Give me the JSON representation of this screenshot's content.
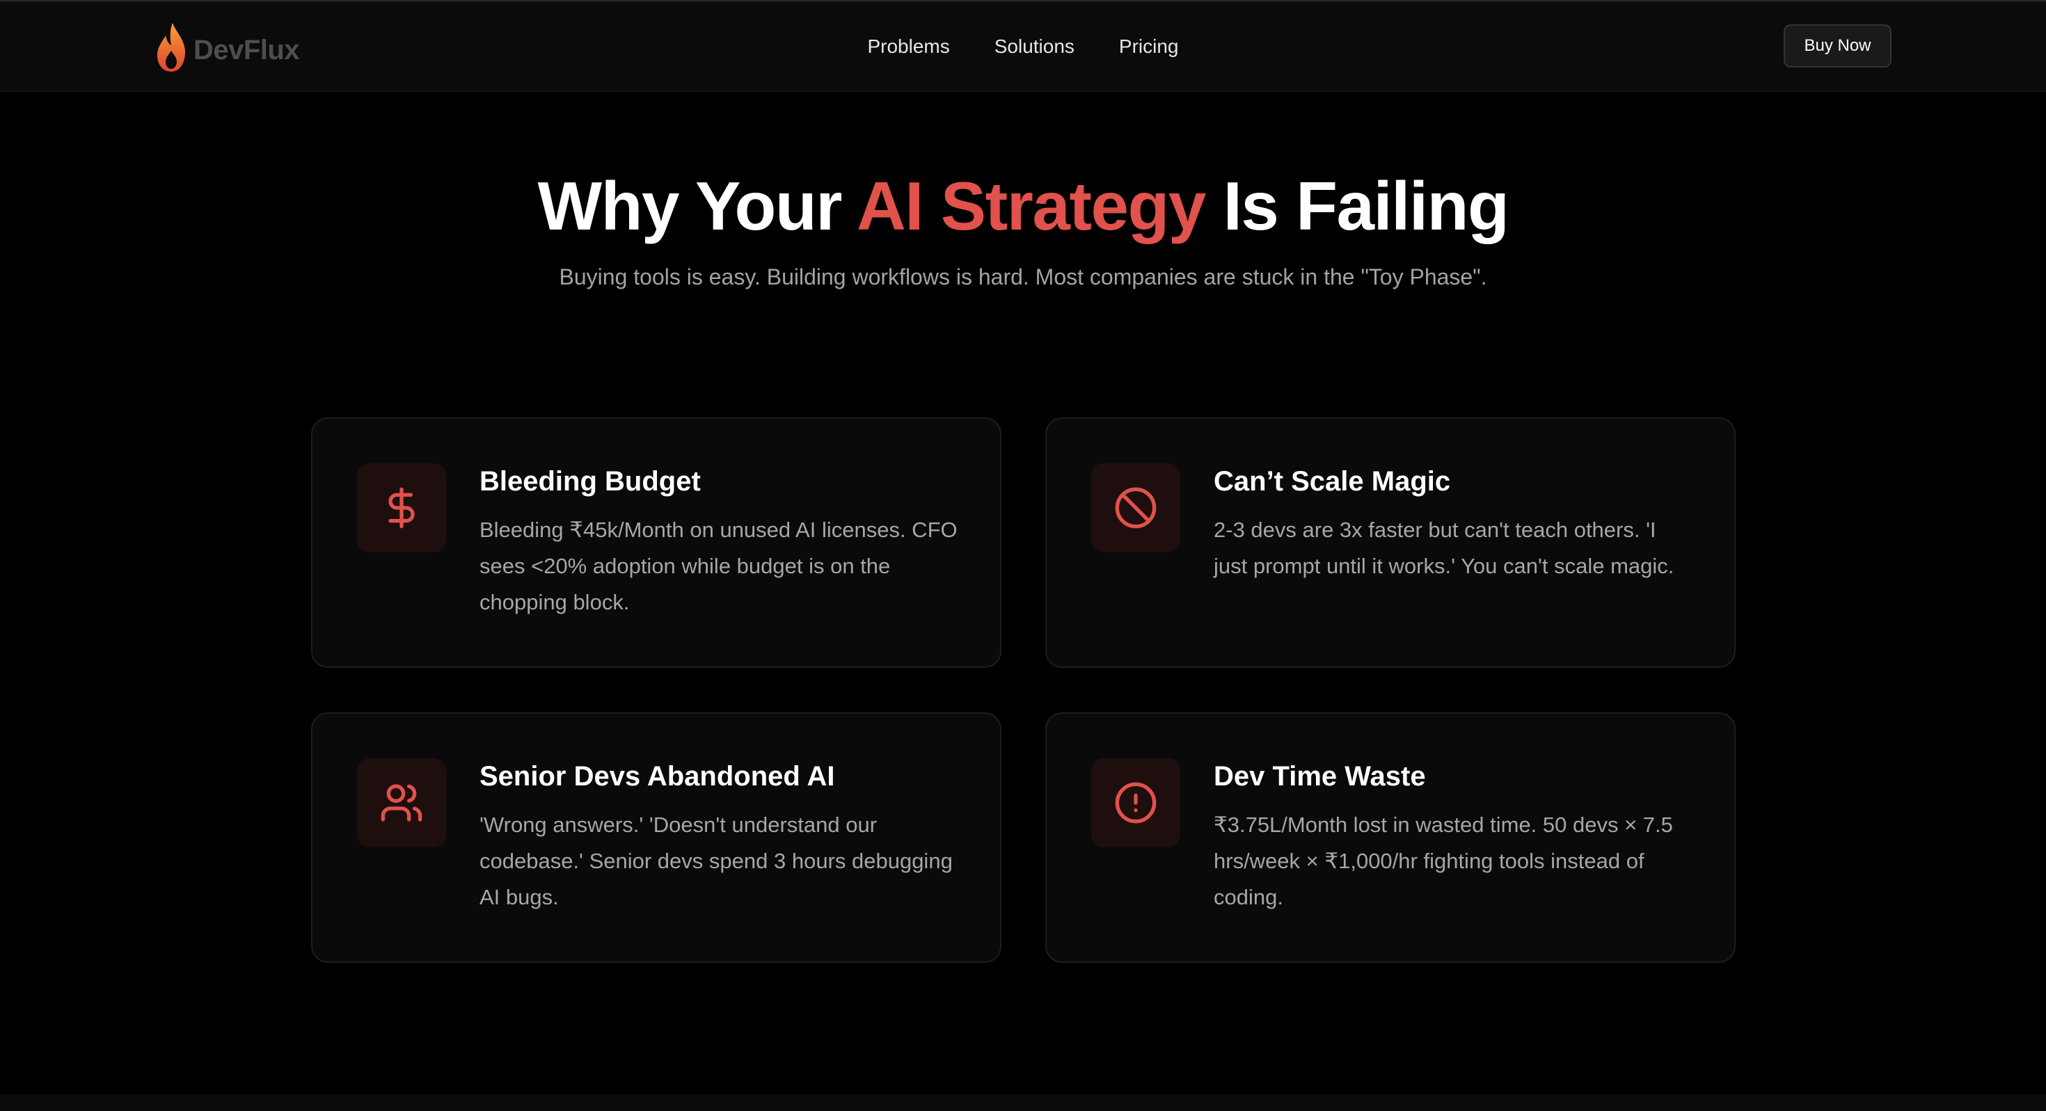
{
  "brand": {
    "name": "DevFlux",
    "logo_icon": "flame-icon",
    "logo_colors": [
      "#f08a2c",
      "#e0452f"
    ]
  },
  "nav": {
    "items": [
      {
        "label": "Problems"
      },
      {
        "label": "Solutions"
      },
      {
        "label": "Pricing"
      }
    ],
    "cta_label": "Buy Now"
  },
  "hero": {
    "title_before": "Why Your ",
    "title_accent": "AI Strategy",
    "title_after": " Is Failing",
    "subtitle": "Buying tools is easy. Building workflows is hard. Most companies are stuck in the \"Toy Phase\"."
  },
  "problems": [
    {
      "icon": "dollar-icon",
      "title": "Bleeding Budget",
      "description": "Bleeding ₹45k/Month on unused AI licenses. CFO sees <20% adoption while budget is on the chopping block."
    },
    {
      "icon": "ban-icon",
      "title": "Can’t Scale Magic",
      "description": "2-3 devs are 3x faster but can't teach others. 'I just prompt until it works.' You can't scale magic."
    },
    {
      "icon": "users-icon",
      "title": "Senior Devs Abandoned AI",
      "description": "'Wrong answers.' 'Doesn't understand our codebase.' Senior devs spend 3 hours debugging AI bugs."
    },
    {
      "icon": "alert-circle-icon",
      "title": "Dev Time Waste",
      "description": "₹3.75L/Month lost in wasted time. 50 devs × 7.5 hrs/week × ₹1,000/hr fighting tools instead of coding."
    }
  ],
  "colors": {
    "background": "#000000",
    "accent": "#e0524b",
    "card_background": "#0a0a0a",
    "icon_box_background": "#1f0e0e",
    "muted_text": "#a6a6ab"
  }
}
